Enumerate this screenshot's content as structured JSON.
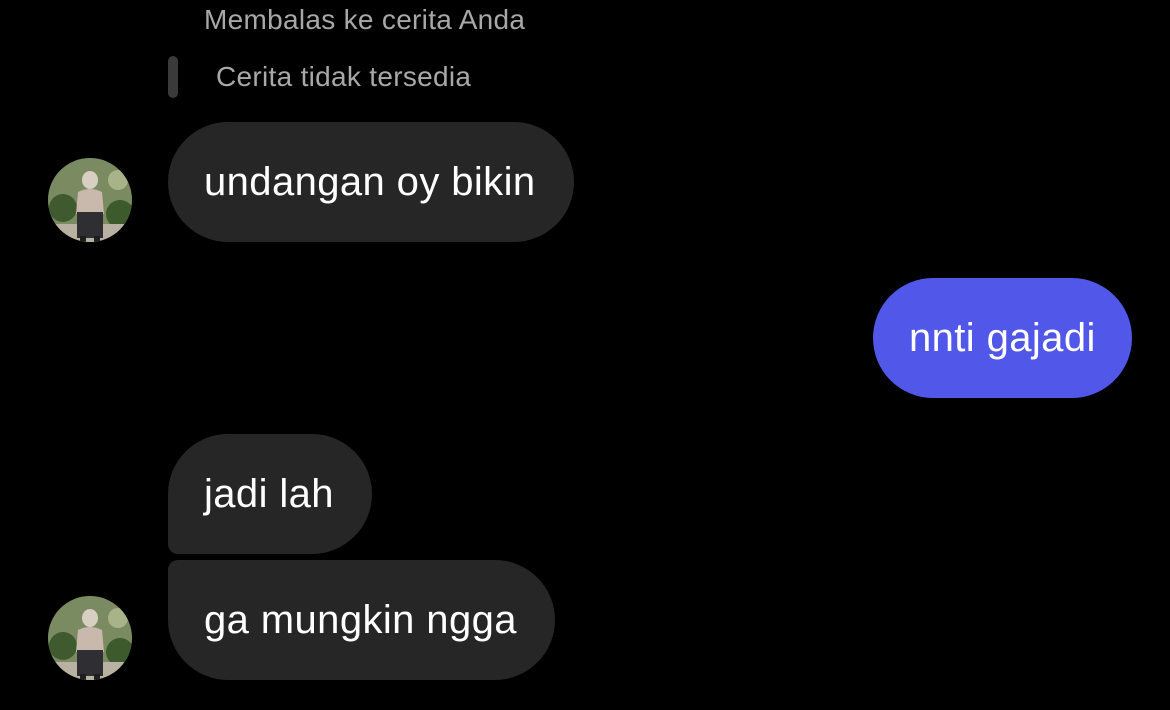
{
  "reply_context": {
    "header": "Membalas ke cerita Anda",
    "quote": "Cerita tidak tersedia"
  },
  "messages": [
    {
      "sender": "other",
      "text": "undangan oy bikin"
    },
    {
      "sender": "me",
      "text": "nnti gajadi"
    },
    {
      "sender": "other",
      "text": "jadi lah"
    },
    {
      "sender": "other",
      "text": "ga mungkin ngga"
    }
  ],
  "colors": {
    "background": "#000000",
    "incoming_bubble": "#262626",
    "outgoing_bubble": "#5157e8",
    "muted_text": "#a8a8a8",
    "message_text": "#ffffff"
  },
  "icons": {
    "avatar": "contact-avatar-photo"
  }
}
